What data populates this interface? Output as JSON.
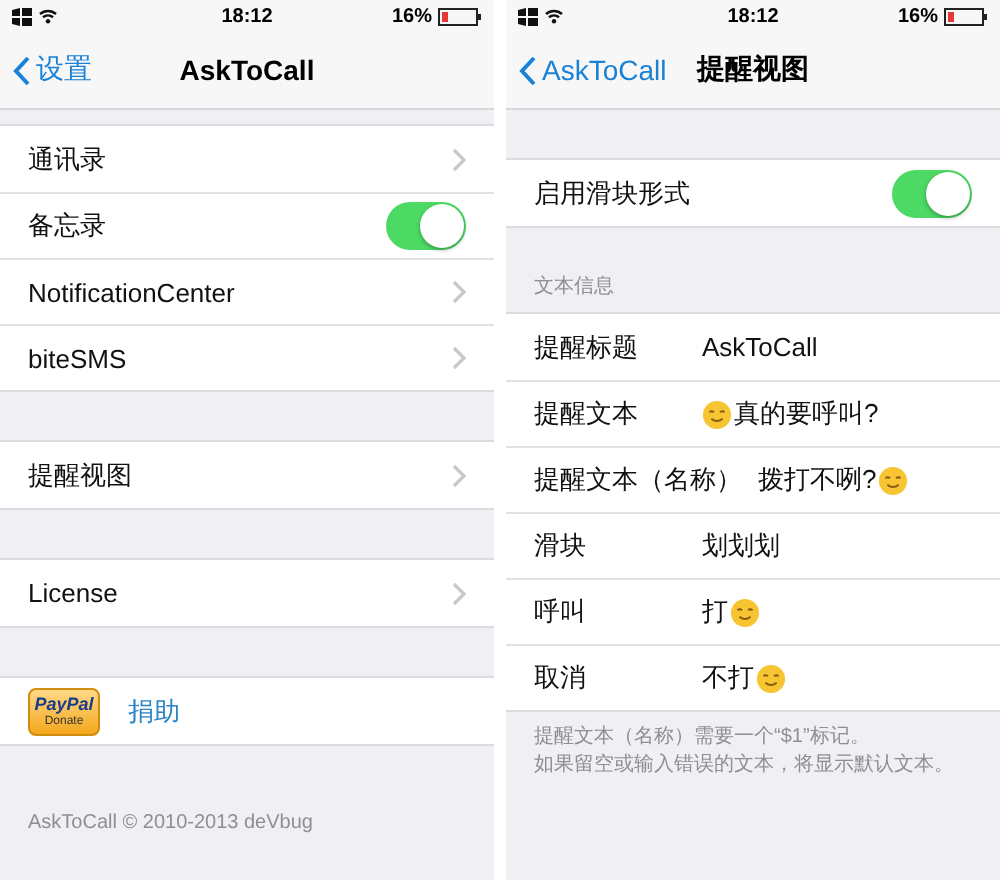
{
  "screens": [
    {
      "status": {
        "time": "18:12",
        "battery": "16%"
      },
      "nav": {
        "back": "设置",
        "title": "AskToCall"
      },
      "groups": [
        {
          "rows": [
            {
              "kind": "link",
              "label": "通讯录"
            },
            {
              "kind": "toggle",
              "label": "备忘录",
              "on": true
            },
            {
              "kind": "link",
              "label": "NotificationCenter"
            },
            {
              "kind": "link",
              "label": "biteSMS"
            }
          ]
        },
        {
          "rows": [
            {
              "kind": "link",
              "label": "提醒视图"
            }
          ]
        },
        {
          "rows": [
            {
              "kind": "link",
              "label": "License"
            }
          ]
        },
        {
          "rows": [
            {
              "kind": "donate",
              "badge_top": "PayPal",
              "badge_bottom": "Donate",
              "label": "捐助"
            }
          ]
        }
      ],
      "footer": [
        "AskToCall © 2010-2013 deVbug"
      ]
    },
    {
      "status": {
        "time": "18:12",
        "battery": "16%"
      },
      "nav": {
        "back": "AskToCall",
        "title": "提醒视图"
      },
      "groups": [
        {
          "rows": [
            {
              "kind": "toggle",
              "label": "启用滑块形式",
              "on": true
            }
          ]
        },
        {
          "header": "文本信息",
          "rows": [
            {
              "kind": "field",
              "label": "提醒标题",
              "value": "AskToCall"
            },
            {
              "kind": "field",
              "label": "提醒文本",
              "value": "真的要呼叫?",
              "face_before": true
            },
            {
              "kind": "field",
              "label": "提醒文本（名称）",
              "value": "拨打不咧?",
              "face_after": true
            },
            {
              "kind": "field",
              "label": "滑块",
              "value": "划划划"
            },
            {
              "kind": "field",
              "label": "呼叫",
              "value": "打",
              "face_after": true
            },
            {
              "kind": "field",
              "label": "取消",
              "value": "不打",
              "face_after": true
            }
          ]
        }
      ],
      "footer": [
        "提醒文本（名称）需要一个“$1”标记。",
        "如果留空或输入错误的文本，将显示默认文本。"
      ]
    }
  ]
}
